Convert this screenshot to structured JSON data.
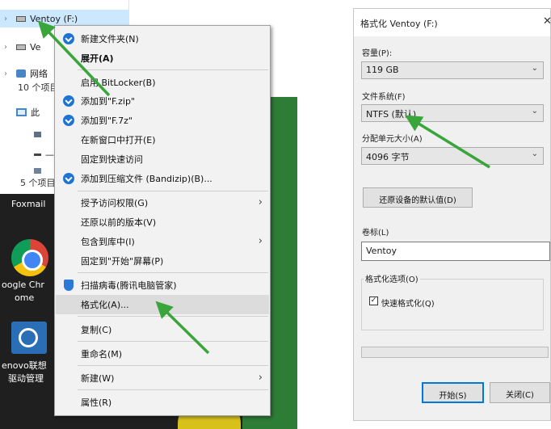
{
  "explorer": {
    "tree_items": [
      {
        "label": "Ventoy (F:)",
        "selected": true
      },
      {
        "label": "Ve"
      },
      {
        "label": "网络"
      },
      {
        "label": "此"
      },
      {
        "label": "—"
      },
      {
        "label": ""
      }
    ],
    "status_top": "10 个项目",
    "status_bottom": "5 个项目"
  },
  "desktop": {
    "icons": [
      {
        "name": "foxmail",
        "label": "Foxmail"
      },
      {
        "name": "chrome",
        "label": "oogle Chr",
        "label2": "ome"
      },
      {
        "name": "lenovo",
        "label": "enovo联想",
        "label2": "驱动管理"
      }
    ]
  },
  "context_menu": {
    "items": [
      {
        "label": "新建文件夹(N)",
        "icon": "bandizip-icon"
      },
      {
        "label": "展开(A)",
        "bold": true
      },
      {
        "label": "启用 BitLocker(B)"
      },
      {
        "label": "添加到\"F.zip\"",
        "icon": "bandizip-icon"
      },
      {
        "label": "添加到\"F.7z\"",
        "icon": "bandizip-icon"
      },
      {
        "label": "在新窗口中打开(E)"
      },
      {
        "label": "固定到快速访问"
      },
      {
        "label": "添加到压缩文件 (Bandizip)(B)...",
        "icon": "bandizip-icon"
      },
      {
        "label": "授予访问权限(G)",
        "submenu": true
      },
      {
        "label": "还原以前的版本(V)"
      },
      {
        "label": "包含到库中(I)",
        "submenu": true
      },
      {
        "label": "固定到\"开始\"屏幕(P)"
      },
      {
        "label": "扫描病毒(腾讯电脑管家)",
        "icon": "shield-icon"
      },
      {
        "label": "格式化(A)...",
        "highlighted": true
      },
      {
        "label": "复制(C)"
      },
      {
        "label": "重命名(M)"
      },
      {
        "label": "新建(W)",
        "submenu": true
      },
      {
        "label": "属性(R)"
      }
    ],
    "submenu_glyph": "›"
  },
  "format_dialog": {
    "title": "格式化 Ventoy (F:)",
    "close_glyph": "✕",
    "capacity_label": "容量(P):",
    "capacity_value": "119 GB",
    "filesystem_label": "文件系统(F)",
    "filesystem_value": "NTFS (默认)",
    "cluster_label": "分配单元大小(A)",
    "cluster_value": "4096 字节",
    "restore_button": "还原设备的默认值(D)",
    "volume_label": "卷标(L)",
    "volume_value": "Ventoy",
    "options_label": "格式化选项(O)",
    "quick_format_label": "快速格式化(Q)",
    "quick_format_checked": true,
    "start_button": "开始(S)",
    "close_button": "关闭(C)",
    "dropdown_glyph": "⌄",
    "check_glyph": "✓"
  },
  "colors": {
    "annotation_arrow": "#3aa53a",
    "selection": "#cce8ff",
    "accent": "#0078d7"
  }
}
